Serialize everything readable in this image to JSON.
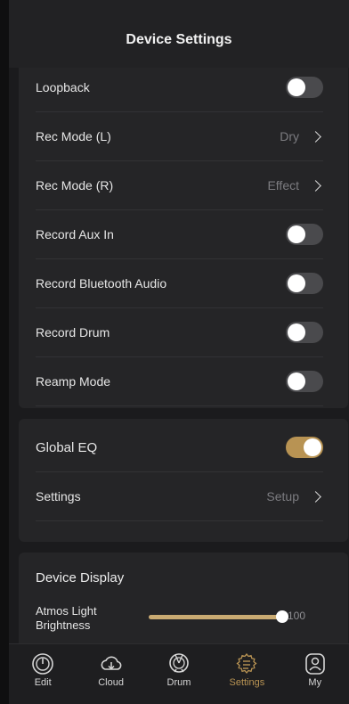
{
  "header": {
    "title": "Device Settings"
  },
  "recording": {
    "items": [
      {
        "label": "Loopback",
        "toggle": false
      },
      {
        "label": "Rec Mode (L)",
        "value": "Dry"
      },
      {
        "label": "Rec Mode (R)",
        "value": "Effect"
      },
      {
        "label": "Record Aux In",
        "toggle": false
      },
      {
        "label": "Record Bluetooth Audio",
        "toggle": false
      },
      {
        "label": "Record Drum",
        "toggle": false
      },
      {
        "label": "Reamp Mode",
        "toggle": false
      }
    ]
  },
  "global_eq": {
    "title": "Global EQ",
    "enabled": true,
    "settings_label": "Settings",
    "settings_value": "Setup"
  },
  "display": {
    "title": "Device Display",
    "brightness_label": "Atmos Light Brightness",
    "brightness_value": "100",
    "brightness_level": 1.0
  },
  "tabs": [
    {
      "label": "Edit",
      "icon": "edit-knob-icon",
      "active": false
    },
    {
      "label": "Cloud",
      "icon": "cloud-download-icon",
      "active": false
    },
    {
      "label": "Drum",
      "icon": "drum-icon",
      "active": false
    },
    {
      "label": "Settings",
      "icon": "settings-gear-icon",
      "active": true
    },
    {
      "label": "My",
      "icon": "profile-icon",
      "active": false
    }
  ],
  "colors": {
    "accent": "#b89353",
    "background": "#1b1b1d",
    "card": "#252527"
  }
}
